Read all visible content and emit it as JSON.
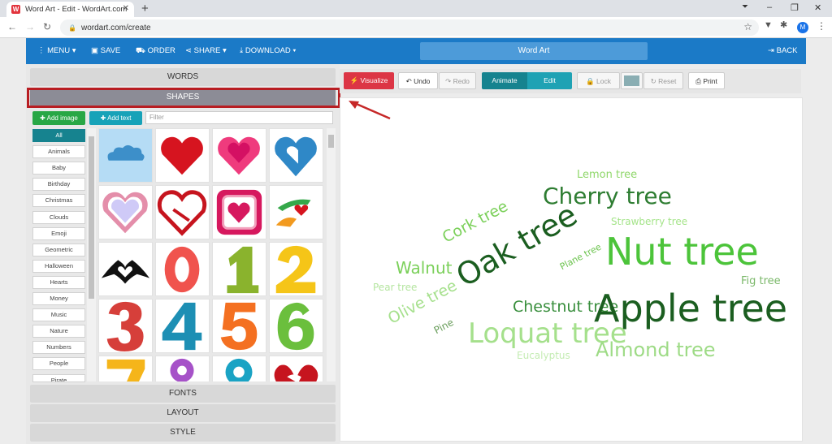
{
  "browser": {
    "tab_title": "Word Art - Edit - WordArt.com",
    "favicon_letter": "W",
    "url": "wordart.com/create",
    "avatar_letter": "M"
  },
  "appbar": {
    "menu": "MENU",
    "save": "SAVE",
    "order": "ORDER",
    "share": "SHARE",
    "download": "DOWNLOAD",
    "title": "Word Art",
    "back": "BACK"
  },
  "left": {
    "words": "WORDS",
    "shapes": "SHAPES",
    "add_image": "Add image",
    "add_text": "Add text",
    "filter_placeholder": "Filter",
    "categories": [
      "All",
      "Animals",
      "Baby",
      "Birthday",
      "Christmas",
      "Clouds",
      "Emoji",
      "Geometric",
      "Halloween",
      "Hearts",
      "Money",
      "Music",
      "Nature",
      "Numbers",
      "People",
      "Pirate"
    ],
    "fonts": "FONTS",
    "layout": "LAYOUT",
    "style": "STYLE"
  },
  "toolbar": {
    "visualize": "Visualize",
    "undo": "Undo",
    "redo": "Redo",
    "animate": "Animate",
    "edit": "Edit",
    "lock": "Lock",
    "reset": "Reset",
    "print": "Print"
  },
  "wordcloud": {
    "lemon": "Lemon tree",
    "cherry": "Cherry tree",
    "strawberry": "Strawberry tree",
    "cork": "Cork tree",
    "oak": "Oak tree",
    "nut": "Nut tree",
    "walnut": "Walnut",
    "plane": "Plane tree",
    "fig": "Fig tree",
    "pear": "Pear tree",
    "olive": "Olive tree",
    "chestnut": "Chestnut tree",
    "apple": "Apple tree",
    "pine": "Pine",
    "loquat": "Loquat tree",
    "almond": "Almond tree",
    "eucalyptus": "Eucalyptus"
  },
  "colors": {
    "appbar": "#1b7ac7",
    "highlight": "#b81d22",
    "teal": "#16838f",
    "green": "#28a745"
  }
}
